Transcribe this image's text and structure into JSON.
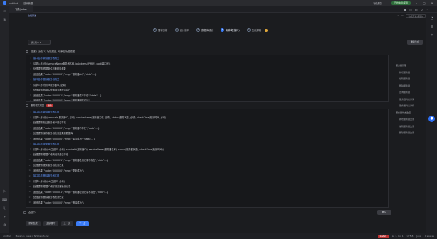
{
  "titlebar": {
    "app_title": "飞鹰(auto)",
    "project": "untitled",
    "menu": "迭代管理",
    "right_label": "功能服务",
    "green_button": "开始体验/使用"
  },
  "tabbar": {
    "tabs": [
      {
        "label": "飞鹰(auto)"
      }
    ]
  },
  "subtab": {
    "label": "功能开发",
    "right_select": "功能开发(项目)"
  },
  "steps": [
    {
      "num": "1",
      "label": "需求分析"
    },
    {
      "num": "2",
      "label": "设计接口"
    },
    {
      "num": "3",
      "label": "数据库设计"
    },
    {
      "num": "4",
      "label": "实体类(接口)"
    },
    {
      "num": "5",
      "label": "生成源码"
    }
  ],
  "version_select": "默认版本 ▾",
  "top_right_button": "重新生成",
  "requirement_label": "描述 / 功能(1) 功能描述, 可添加功能描述",
  "box1_lines": [
    {
      "text": "接口名称:新增服务器相关",
      "blue": true
    },
    {
      "text": "请求入参对象(serviceName服务器名称, ipAddress(IP地址), port(端口号))",
      "blue": false
    },
    {
      "text": "处理逻辑:根据条件判断校验参数",
      "blue": false
    },
    {
      "text": "返回结果{\"code\":\"000000\",\"msg\":\"服务器(id)\",\"data\":...}",
      "blue": false
    },
    {
      "text": "接口名称:删除服务器相关",
      "blue": true
    },
    {
      "text": "请求入参对象(id服务器ID, 必填)",
      "blue": false
    },
    {
      "text": "处理逻辑:根据ID查询服务器是否存在",
      "blue": false
    },
    {
      "text": "返回结果{\"code\":\"000001\",\"msg\":\"服务器或不存在\",\"data\":...}",
      "blue": false
    },
    {
      "text": "返回结果{\"code\":\"000000\",\"msg\":\"服务器删除成功\"}",
      "blue": false
    }
  ],
  "box2_header": {
    "label": "服务端实现类",
    "tag": "删除"
  },
  "box2_lines": [
    {
      "text": "接口名称:新增服务器实现",
      "blue": true
    },
    {
      "text": "请求入参对象(serviceId 服务器ID, 必填), serviceName(服务器名称, 必填), status(服务状态, 必填), checkTime(检测时间, 必填)",
      "blue": false
    },
    {
      "text": "处理逻辑:验证服务器ID是否存在",
      "blue": false
    },
    {
      "text": "返回结果{\"code\":\"000000\",\"msg\":\"服务器不存在\",\"data\":...}",
      "blue": false
    },
    {
      "text": "处理逻辑:保存服务器检测结果到数据库",
      "blue": false
    },
    {
      "text": "返回结果{\"code\":\"000000\",\"msg\":\"保存成功\",\"data\":...}",
      "blue": false
    },
    {
      "text": "接口名称:更新服务器实现",
      "blue": true
    },
    {
      "text": "请求入参对象(id(主键ID, 必填), serviceId(服务器ID), serviceName(服务器名称), status(服务器状态), checkTime(检测时间))",
      "blue": false
    },
    {
      "text": "处理逻辑:根据ID查询记录是否存在",
      "blue": false
    },
    {
      "text": "返回结果{\"code\":\"000001\",\"msg\":\"服务器检测记录不存在\",\"data\":...}",
      "blue": false
    },
    {
      "text": "处理逻辑:更新服务器检测记录",
      "blue": false
    },
    {
      "text": "返回结果{\"code\":\"000000\",\"msg\":\"更新成功\"}",
      "blue": false
    },
    {
      "text": "接口名称:删除服务器实现",
      "blue": true
    },
    {
      "text": "请求入参对象(id(主键ID, 必填))",
      "blue": false
    },
    {
      "text": "处理逻辑:根据ID删除服务器检测记录",
      "blue": false
    },
    {
      "text": "返回结果{\"code\":\"000001\",\"msg\":\"服务器检测记录不存在\",\"data\":...}",
      "blue": false
    },
    {
      "text": "处理逻辑:删除服务器检测记录",
      "blue": false
    },
    {
      "text": "返回结果{\"code\":\"000000\",\"msg\":\"删除成功\"}",
      "blue": false
    }
  ],
  "side_tree": [
    {
      "label": "服务器管理",
      "child": false
    },
    {
      "label": "新增服务器",
      "child": true
    },
    {
      "label": "编辑服务器",
      "child": true
    },
    {
      "label": "删除服务器",
      "child": true
    },
    {
      "label": "查询服务器",
      "child": true
    },
    {
      "label": "服务器列表详情",
      "child": true
    },
    {
      "label": "服务器列表详情",
      "child": true
    },
    {
      "label": "服务器状态监控",
      "child": false
    },
    {
      "label": "新增服务器监测",
      "child": true
    },
    {
      "label": "编辑服务器监测",
      "child": true
    },
    {
      "label": "删除服务器监测",
      "child": true
    }
  ],
  "bottom_check_label": "全选中",
  "confirm_button": "确认",
  "actions": [
    {
      "label": "重新生成",
      "primary": false
    },
    {
      "label": "全部展开",
      "primary": false
    },
    {
      "label": "上一步",
      "primary": false
    },
    {
      "label": "下一步",
      "primary": true
    }
  ],
  "statusbar": {
    "branch": "untitled",
    "path": "Maven > rules > fs  Wrench.md",
    "right_items": [
      "Ln 1, Col 1",
      "UTF-8",
      "Java",
      "4 spaces"
    ],
    "red_indicator": "Install"
  }
}
